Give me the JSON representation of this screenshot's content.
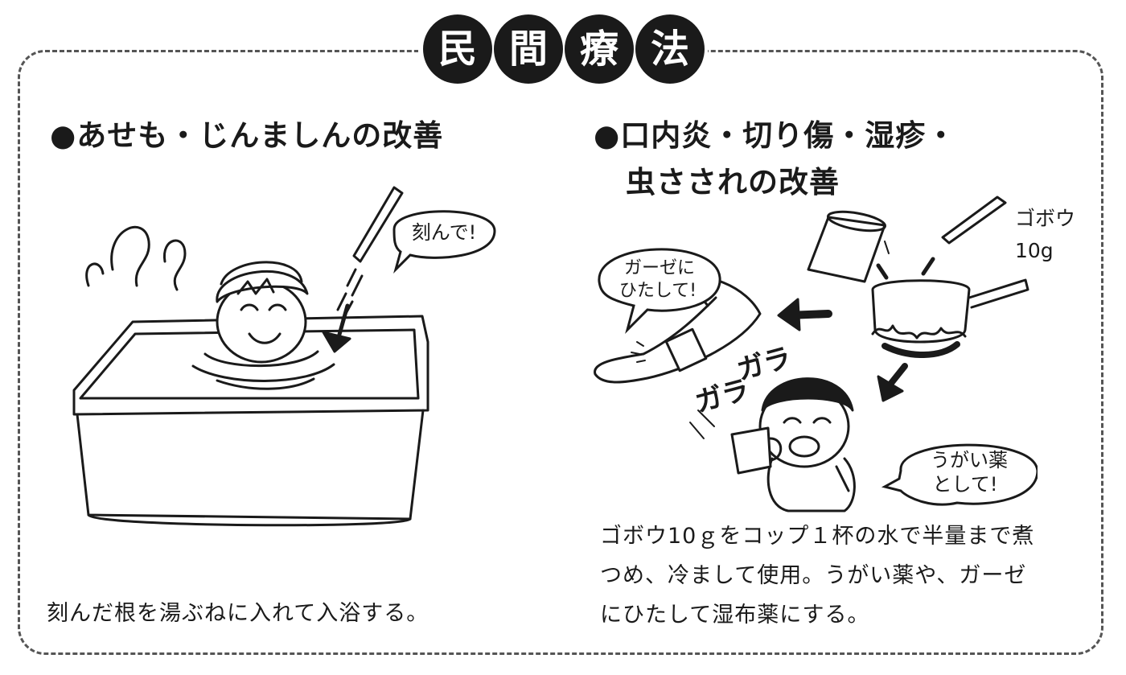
{
  "title": {
    "chars": [
      "民",
      "間",
      "療",
      "法"
    ]
  },
  "left": {
    "heading": "●あせも・じんましんの改善",
    "bubble": "刻んで!",
    "caption": "刻んだ根を湯ぶねに入れて入浴する。"
  },
  "right": {
    "heading_line1": "●口内炎・切り傷・湿疹・",
    "heading_line2": "虫さされの改善",
    "burdock_label": "ゴボウ",
    "burdock_amount": "10g",
    "bubble_gauze_line1": "ガーゼに",
    "bubble_gauze_line2": "ひたして!",
    "bubble_gargle_line1": "うがい薬",
    "bubble_gargle_line2": "として!",
    "sfx_1": "ガラ",
    "sfx_2": "ガラ",
    "caption_line1": "ゴボウ10ｇをコップ１杯の水で半量まで煮",
    "caption_line2": "つめ、冷まして使用。うがい薬や、ガーゼ",
    "caption_line3": "にひたして湿布薬にする。"
  }
}
